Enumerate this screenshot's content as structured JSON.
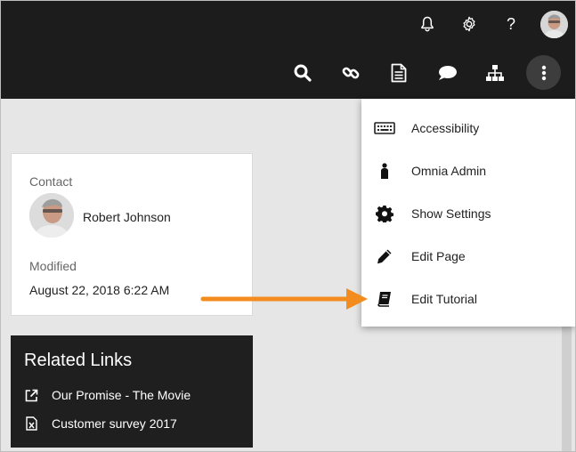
{
  "header": {
    "icons": [
      "bell-icon",
      "gear-icon",
      "help-icon",
      "user-avatar"
    ],
    "toolbar_icons": [
      "search-icon",
      "link-icon",
      "document-icon",
      "comment-icon",
      "sitemap-icon",
      "more-vertical-icon"
    ]
  },
  "help_label": "?",
  "contact": {
    "label": "Contact",
    "name": "Robert Johnson",
    "modified_label": "Modified",
    "modified_value": "August 22, 2018 6:22 AM"
  },
  "related_links": {
    "title": "Related Links",
    "items": [
      {
        "label": "Our Promise - The Movie",
        "icon": "external-link-icon"
      },
      {
        "label": "Customer survey 2017",
        "icon": "excel-file-icon"
      }
    ]
  },
  "menu": {
    "items": [
      {
        "label": "Accessibility",
        "icon": "keyboard-icon"
      },
      {
        "label": "Omnia Admin",
        "icon": "person-icon"
      },
      {
        "label": "Show Settings",
        "icon": "gear-icon"
      },
      {
        "label": "Edit Page",
        "icon": "pencil-icon"
      },
      {
        "label": "Edit Tutorial",
        "icon": "book-icon"
      }
    ]
  },
  "colors": {
    "topbar": "#1c1c1c",
    "arrow": "#f28c1e",
    "related_bg": "#1f1f1f"
  }
}
